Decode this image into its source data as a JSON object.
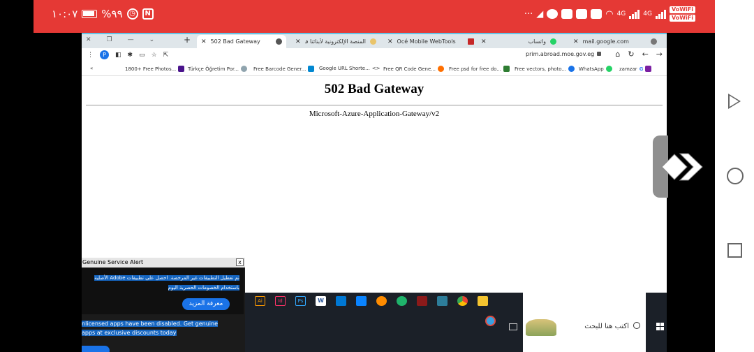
{
  "statusbar": {
    "time": "١٠:٠٧",
    "battery": "%٩٩",
    "net1": "4G",
    "net2": "4G",
    "wifi1": "VoWiFi",
    "wifi2": "VoWiFi",
    "more": "···"
  },
  "browser": {
    "tabs": [
      {
        "title": "mail.google.com",
        "active": false,
        "color": "#ea4335"
      },
      {
        "title": "واتساب",
        "active": false,
        "color": "#25d366"
      },
      {
        "title": "Océ Mobile WebTools",
        "active": false,
        "color": "#c62828"
      },
      {
        "title": "المنصة الإلكترونية لأبنائنا في ...",
        "active": false,
        "color": "#e9c46a"
      },
      {
        "title": "502 Bad Gateway",
        "active": true,
        "color": "#333333"
      }
    ],
    "new_tab": "+",
    "url": "prim.abroad.moe.gov.eg",
    "profile_initial": "P",
    "bookmarks": [
      {
        "label": "zamzar",
        "color": "#7b1fa2"
      },
      {
        "label": "WhatsApp",
        "color": "#25d366"
      },
      {
        "label": "Free vectors, photo...",
        "color": "#1a73e8"
      },
      {
        "label": "Free psd for free do...",
        "color": "#2e7d32"
      },
      {
        "label": "Free QR Code Gene...",
        "color": "#ff6f00"
      },
      {
        "label": "Google URL Shorte...",
        "color": "#333333"
      },
      {
        "label": "Free Barcode Gener...",
        "color": "#0288d1"
      },
      {
        "label": "Türkçe Öğretim Por...",
        "color": "#90a4ae"
      },
      {
        "label": "1800+ Free Photos...",
        "color": "#4a148c"
      }
    ],
    "bookmarks_more": "«"
  },
  "page": {
    "title": "502 Bad Gateway",
    "server": "Microsoft-Azure-Application-Gateway/v2"
  },
  "alert": {
    "title": "Genuine Service Alert",
    "close": "x",
    "arabic": "تم تعطيل التطبيقات غير المرخصة. احصل على تطبيقات Adobe الأصلية باستخدام الخصومات الحصرية اليوم",
    "learn_more": "معرفة المزيد",
    "english_line1": "nlicensed apps have been disabled. Get genuine",
    "english_line2": "apps at exclusive discounts today"
  },
  "taskbar": {
    "search_placeholder": "اكتب هنا للبحث",
    "apps": [
      {
        "name": "illustrator",
        "label": "Ai",
        "color": "#ff9a00"
      },
      {
        "name": "indesign",
        "label": "Id",
        "color": "#ff3366"
      },
      {
        "name": "photoshop",
        "label": "Ps",
        "color": "#31a8ff"
      },
      {
        "name": "word",
        "label": "W",
        "color": "#2b579a"
      },
      {
        "name": "app5",
        "label": "",
        "color": "#0078d4"
      },
      {
        "name": "mail",
        "label": "",
        "color": "#0a84ff"
      },
      {
        "name": "search-app",
        "label": "",
        "color": "#ff8c00"
      },
      {
        "name": "edge",
        "label": "",
        "color": "#1fb36b"
      },
      {
        "name": "app9",
        "label": "",
        "color": "#8b1a1a"
      },
      {
        "name": "store",
        "label": "",
        "color": "#2d7d9a"
      },
      {
        "name": "chrome",
        "label": "",
        "color": "#fbbc05"
      },
      {
        "name": "explorer",
        "label": "",
        "color": "#f4c430"
      }
    ]
  }
}
